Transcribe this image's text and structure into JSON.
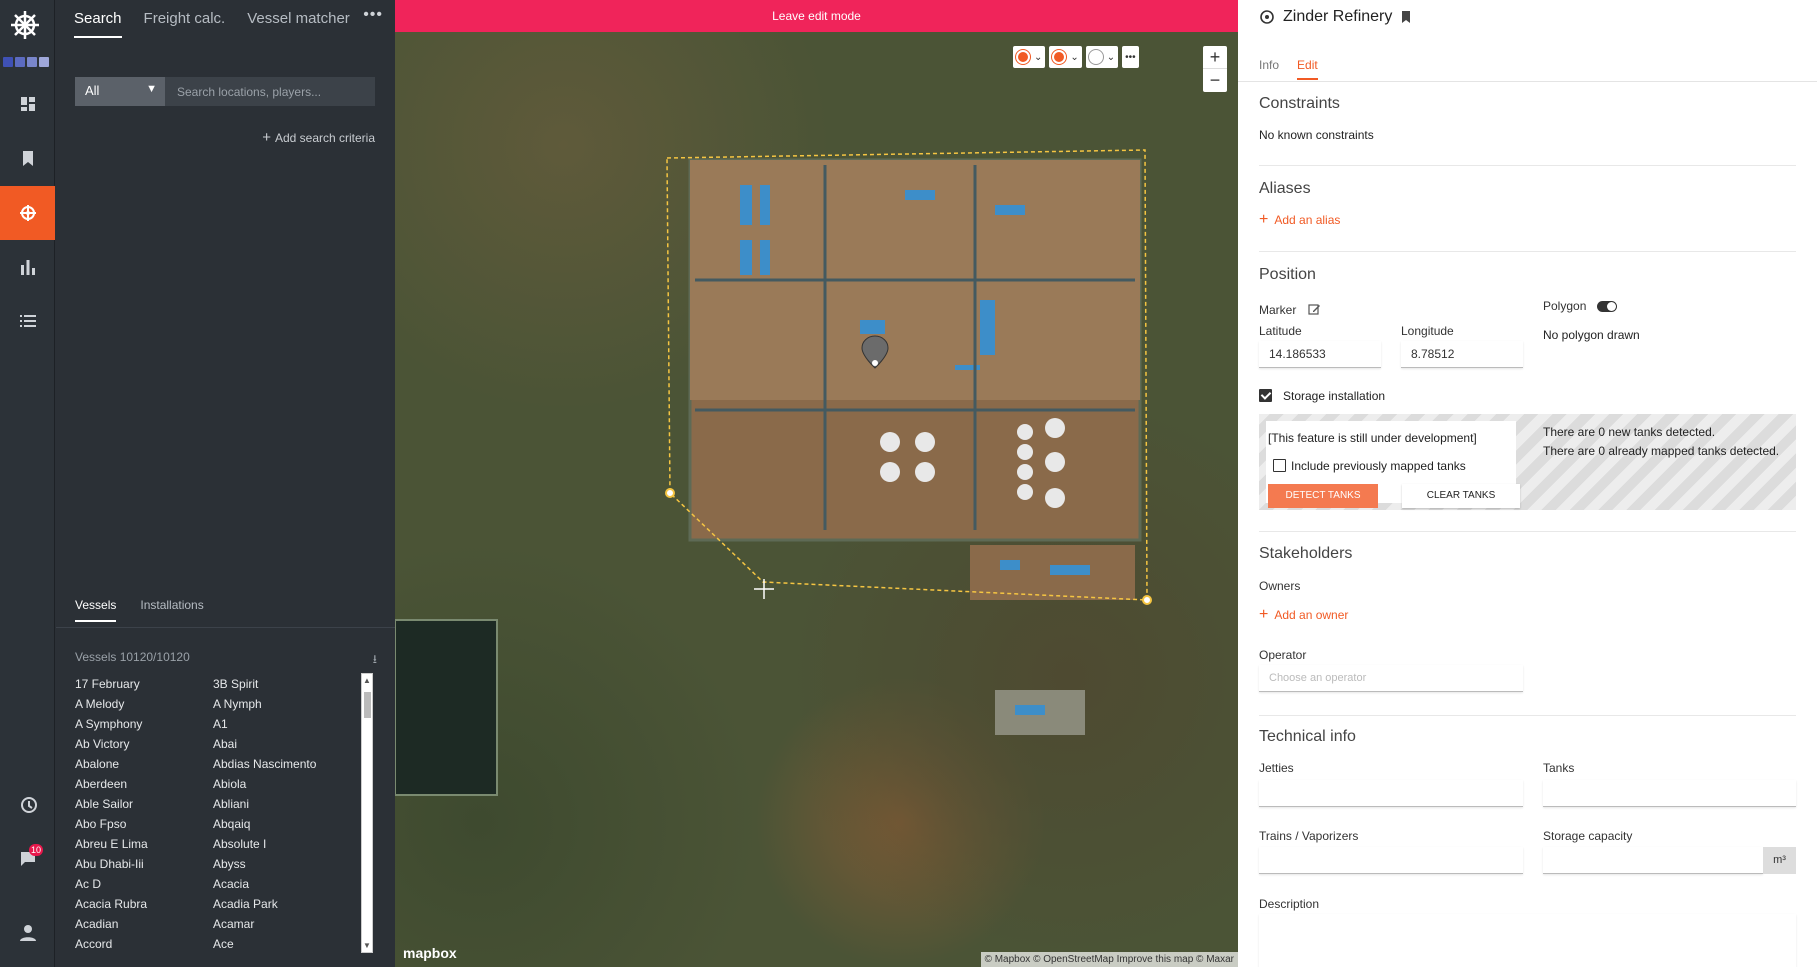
{
  "search_panel": {
    "tabs": [
      "Search",
      "Freight calc.",
      "Vessel matcher"
    ],
    "filter_select": "All",
    "search_placeholder": "Search locations, players...",
    "add_criteria": "Add search criteria",
    "sub_tabs": [
      "Vessels",
      "Installations"
    ],
    "vessel_count": "Vessels 10120/10120",
    "vessels": [
      "17 February",
      "3B Spirit",
      "A Melody",
      "A Nymph",
      "A Symphony",
      "A1",
      "Ab Victory",
      "Abai",
      "Abalone",
      "Abdias Nascimento",
      "Aberdeen",
      "Abiola",
      "Able Sailor",
      "Abliani",
      "Abo Fpso",
      "Abqaiq",
      "Abreu E Lima",
      "Absolute I",
      "Abu Dhabi-Iii",
      "Abyss",
      "Ac D",
      "Acacia",
      "Acacia Rubra",
      "Acadia Park",
      "Acadian",
      "Acamar",
      "Accord",
      "Ace"
    ]
  },
  "rail": {
    "notification_count": "10"
  },
  "map": {
    "banner": "Leave edit mode",
    "mapbox": "mapbox",
    "attribution": "© Mapbox © OpenStreetMap Improve this map © Maxar"
  },
  "detail": {
    "title": "Zinder Refinery",
    "tabs": [
      "Info",
      "Edit"
    ],
    "constraints_title": "Constraints",
    "constraints_text": "No known constraints",
    "aliases_title": "Aliases",
    "add_alias": "Add an alias",
    "position_title": "Position",
    "marker_label": "Marker",
    "polygon_label": "Polygon",
    "latitude_label": "Latitude",
    "longitude_label": "Longitude",
    "latitude": "14.186533",
    "longitude": "8.78512",
    "polygon_text": "No polygon drawn",
    "storage_label": "Storage installation",
    "dev_notice": "[This feature is still under development]",
    "include_mapped": "Include previously mapped tanks",
    "detect_btn": "DETECT TANKS",
    "clear_btn": "CLEAR TANKS",
    "new_tanks": "There are 0 new tanks detected.",
    "mapped_tanks": "There are 0 already mapped tanks detected.",
    "stakeholders_title": "Stakeholders",
    "owners_label": "Owners",
    "add_owner": "Add an owner",
    "operator_label": "Operator",
    "operator_placeholder": "Choose an operator",
    "technical_title": "Technical info",
    "jetties_label": "Jetties",
    "tanks_label": "Tanks",
    "trains_label": "Trains / Vaporizers",
    "storage_capacity_label": "Storage capacity",
    "unit": "m³",
    "description_label": "Description"
  }
}
